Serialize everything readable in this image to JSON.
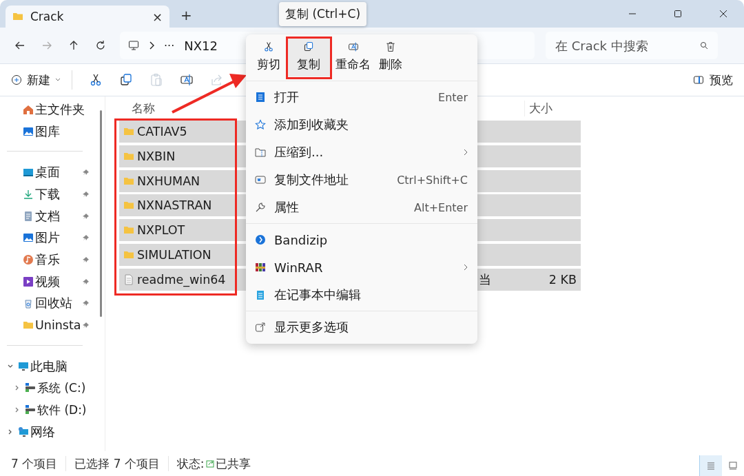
{
  "tab": {
    "title": "Crack",
    "close": "×",
    "new_tab": "+"
  },
  "address": {
    "ellipsis": "···",
    "segment": "NX12"
  },
  "search": {
    "placeholder": "在 Crack 中搜索"
  },
  "toolbar": {
    "new_label": "新建",
    "preview_label": "预览",
    "buttons": [
      {
        "kind": "cut",
        "disabled": false
      },
      {
        "kind": "copy",
        "disabled": false
      },
      {
        "kind": "paste",
        "disabled": true
      },
      {
        "kind": "rename",
        "disabled": false
      },
      {
        "kind": "share",
        "disabled": true
      }
    ]
  },
  "sidebar": {
    "quick": [
      {
        "label": "主文件夹",
        "pinned": false
      },
      {
        "label": "图库",
        "pinned": false
      }
    ],
    "pinned": [
      {
        "label": "桌面",
        "pinned": true
      },
      {
        "label": "下载",
        "pinned": true
      },
      {
        "label": "文档",
        "pinned": true
      },
      {
        "label": "图片",
        "pinned": true
      },
      {
        "label": "音乐",
        "pinned": true
      },
      {
        "label": "视频",
        "pinned": true
      },
      {
        "label": "回收站",
        "pinned": true
      },
      {
        "label": "Uninsta",
        "pinned": true
      }
    ],
    "tree": [
      {
        "label": "此电脑",
        "expanded": true,
        "children": [
          {
            "label": "系统 (C:)",
            "expanded": false
          },
          {
            "label": "软件 (D:)",
            "expanded": false
          }
        ]
      },
      {
        "label": "网络",
        "expanded": false
      }
    ]
  },
  "files": {
    "columns": [
      "名称",
      "大小"
    ],
    "rows": [
      {
        "name": "CATIAV5",
        "kind": "folder",
        "selected": true
      },
      {
        "name": "NXBIN",
        "kind": "folder",
        "selected": true
      },
      {
        "name": "NXHUMAN",
        "kind": "folder",
        "selected": true
      },
      {
        "name": "NXNASTRAN",
        "kind": "folder",
        "selected": true
      },
      {
        "name": "NXPLOT",
        "kind": "folder",
        "selected": true
      },
      {
        "name": "SIMULATION",
        "kind": "folder",
        "selected": true
      },
      {
        "name": "readme_win64",
        "kind": "file",
        "selected": true,
        "type": "当",
        "size": "2 KB"
      }
    ]
  },
  "tooltip": "复制 (Ctrl+C)",
  "context_menu": {
    "actions": [
      {
        "kind": "cut",
        "label": "剪切",
        "selected": false
      },
      {
        "kind": "copy",
        "label": "复制",
        "selected": true
      },
      {
        "kind": "rename",
        "label": "重命名",
        "selected": false
      },
      {
        "kind": "delete",
        "label": "删除",
        "selected": false
      }
    ],
    "groups": [
      [
        {
          "label": "打开",
          "shortcut": "Enter",
          "submenu": false
        },
        {
          "label": "添加到收藏夹",
          "submenu": false
        },
        {
          "label": "压缩到...",
          "submenu": true
        },
        {
          "label": "复制文件地址",
          "shortcut": "Ctrl+Shift+C",
          "submenu": false
        },
        {
          "label": "属性",
          "shortcut": "Alt+Enter",
          "submenu": false
        }
      ],
      [
        {
          "label": "Bandizip",
          "submenu": false
        },
        {
          "label": "WinRAR",
          "submenu": true
        },
        {
          "label": "在记事本中编辑",
          "submenu": false
        }
      ],
      [
        {
          "label": "显示更多选项",
          "submenu": false
        }
      ]
    ]
  },
  "status_bar": {
    "count": "7 个项目",
    "selection": "已选择 7 个项目",
    "state_label": "状态:",
    "state": "已共享",
    "views": [
      {
        "kind": "details",
        "selected": true
      },
      {
        "kind": "tiles",
        "selected": false
      }
    ]
  }
}
